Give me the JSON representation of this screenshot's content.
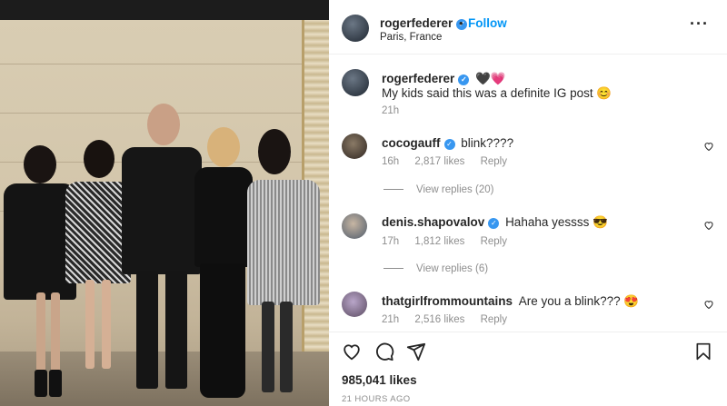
{
  "post": {
    "author": "rogerfederer",
    "location": "Paris, France",
    "follow_label": "Follow",
    "caption_author": "rogerfederer",
    "caption_emojis": "🖤💗",
    "caption": "My kids said this was a definite IG post 😊",
    "caption_time": "21h",
    "likes": "985,041 likes",
    "posted": "21 HOURS AGO"
  },
  "comments": [
    {
      "user": "cocogauff",
      "verified": true,
      "text": "blink????",
      "time": "16h",
      "likes": "2,817 likes",
      "reply": "Reply",
      "view_replies": "View replies (20)"
    },
    {
      "user": "denis.shapovalov",
      "verified": true,
      "text": "Hahaha yessss 😎",
      "time": "17h",
      "likes": "1,812 likes",
      "reply": "Reply",
      "view_replies": "View replies (6)"
    },
    {
      "user": "thatgirlfrommountains",
      "verified": false,
      "text": "Are you a blink??? 😍",
      "time": "21h",
      "likes": "2,516 likes",
      "reply": "Reply"
    }
  ],
  "icons": {
    "more": "more-options-icon",
    "like": "heart-icon",
    "comment": "comment-icon",
    "share": "share-icon",
    "save": "bookmark-icon"
  },
  "colors": {
    "link": "#0095f6",
    "verified": "#3897f0",
    "meta": "#8e8e8e"
  }
}
